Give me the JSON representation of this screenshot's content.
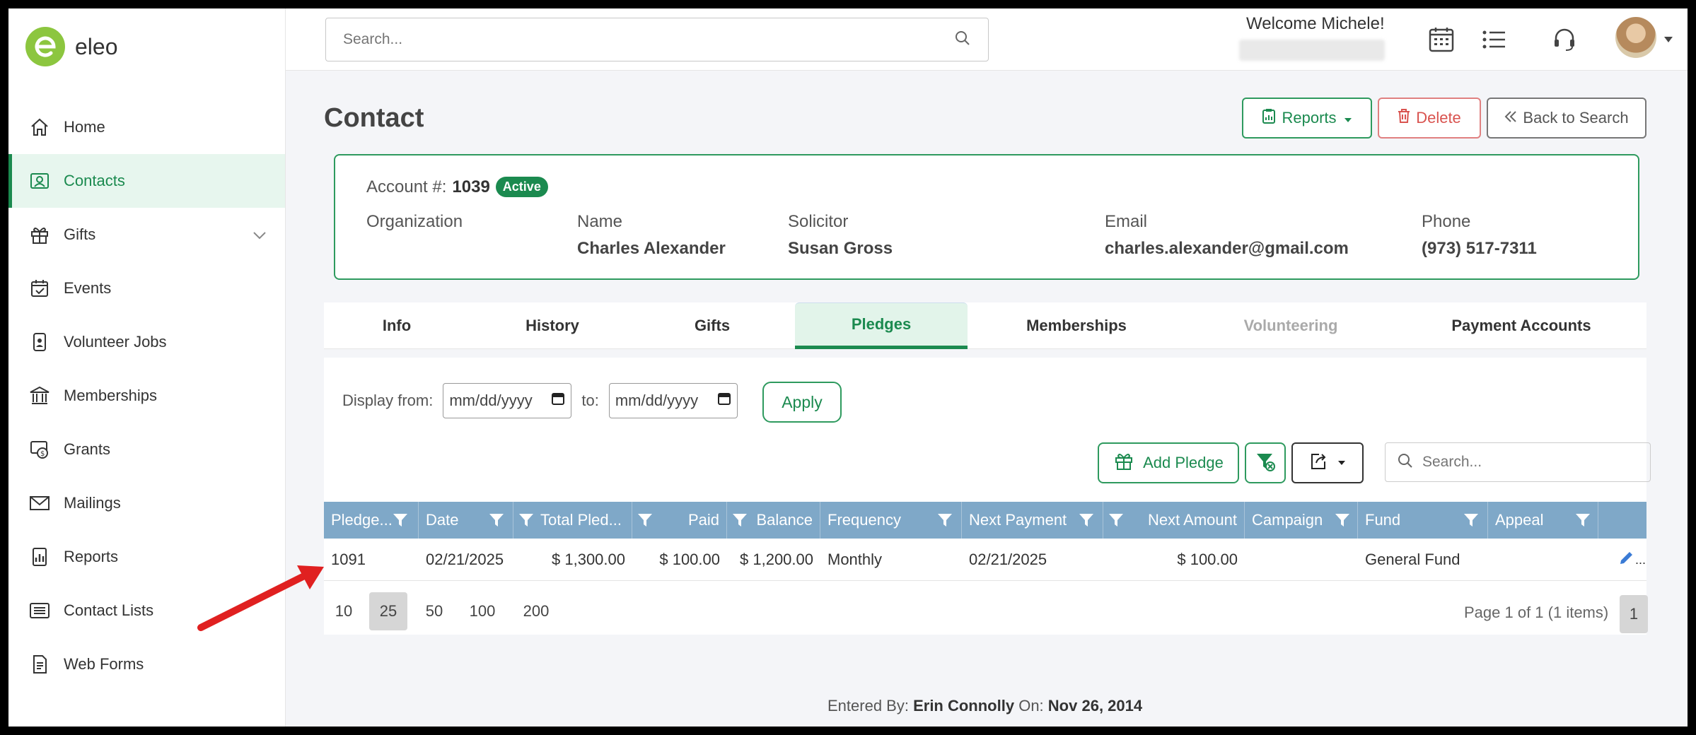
{
  "brand": {
    "name": "eleo"
  },
  "sidebar": {
    "items": [
      {
        "label": "Home",
        "icon": "home-icon"
      },
      {
        "label": "Contacts",
        "icon": "contacts-icon",
        "active": true
      },
      {
        "label": "Gifts",
        "icon": "gift-icon",
        "expandable": true
      },
      {
        "label": "Events",
        "icon": "calendar-check-icon"
      },
      {
        "label": "Volunteer Jobs",
        "icon": "badge-icon"
      },
      {
        "label": "Memberships",
        "icon": "bank-icon"
      },
      {
        "label": "Grants",
        "icon": "grants-icon"
      },
      {
        "label": "Mailings",
        "icon": "envelope-icon"
      },
      {
        "label": "Reports",
        "icon": "report-chart-icon"
      },
      {
        "label": "Contact Lists",
        "icon": "list-icon"
      },
      {
        "label": "Web Forms",
        "icon": "form-icon"
      }
    ]
  },
  "topbar": {
    "search_placeholder": "Search...",
    "welcome": "Welcome Michele!"
  },
  "page": {
    "title": "Contact",
    "buttons": {
      "reports": "Reports",
      "delete": "Delete",
      "back": "Back to Search"
    }
  },
  "account": {
    "label": "Account #:",
    "number": "1039",
    "status": "Active",
    "fields": [
      {
        "label": "Organization",
        "value": ""
      },
      {
        "label": "Name",
        "value": "Charles Alexander"
      },
      {
        "label": "Solicitor",
        "value": "Susan Gross"
      },
      {
        "label": "Email",
        "value": "charles.alexander@gmail.com"
      },
      {
        "label": "Phone",
        "value": "(973) 517-7311"
      }
    ]
  },
  "tabs": [
    {
      "label": "Info"
    },
    {
      "label": "History"
    },
    {
      "label": "Gifts"
    },
    {
      "label": "Pledges",
      "active": true
    },
    {
      "label": "Memberships"
    },
    {
      "label": "Volunteering",
      "disabled": true
    },
    {
      "label": "Payment Accounts"
    }
  ],
  "filters": {
    "display_from": "Display from:",
    "to": "to:",
    "date_placeholder": "mm/dd/yyyy",
    "apply": "Apply"
  },
  "toolbar": {
    "add_pledge": "Add Pledge",
    "search_placeholder": "Search..."
  },
  "grid": {
    "columns": [
      "Pledge...",
      "Date",
      "Total Pled...",
      "Paid",
      "Balance",
      "Frequency",
      "Next Payment",
      "Next Amount",
      "Campaign",
      "Fund",
      "Appeal"
    ],
    "rows": [
      [
        "1091",
        "02/21/2025",
        "$ 1,300.00",
        "$ 100.00",
        "$ 1,200.00",
        "Monthly",
        "02/21/2025",
        "$ 100.00",
        "",
        "General Fund",
        ""
      ]
    ],
    "row_action_more": "..."
  },
  "pager": {
    "sizes": [
      "10",
      "25",
      "50",
      "100",
      "200"
    ],
    "active_size": "25",
    "info": "Page 1 of 1 (1 items)",
    "current_page": "1"
  },
  "footer": {
    "entered_by_label": "Entered By:",
    "entered_by": "Erin Connolly",
    "on_label": "On:",
    "date": "Nov 26, 2014"
  },
  "colors": {
    "accent": "#1b8a4f",
    "grid_header": "#7fa8c8",
    "annotation_arrow": "#e02020"
  }
}
